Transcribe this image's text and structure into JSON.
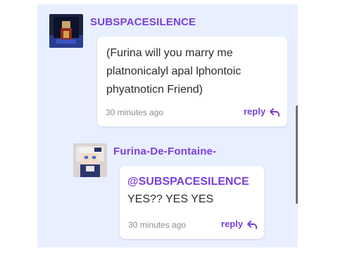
{
  "colors": {
    "accent": "#7a3fd9",
    "panel_bg": "#e8efff",
    "card_bg": "#ffffff",
    "timestamp": "#8a8d96"
  },
  "comments": [
    {
      "username": "SUBSPACESILENCE",
      "avatar_icon": "user-avatar-image",
      "body": "(Furina will you marry me\nplatnonicalyl apal lphontoic\nphyatnoticn Friend)",
      "timestamp": "30 minutes ago",
      "reply_label": "reply",
      "reply_icon": "reply-arrow-icon"
    },
    {
      "username": "Furina-De-Fontaine-",
      "avatar_icon": "user-avatar-image",
      "mention": "@SUBSPACESILENCE",
      "body": "YES?? YES YES",
      "timestamp": "30 minutes ago",
      "reply_label": "reply",
      "reply_icon": "reply-arrow-icon"
    }
  ]
}
